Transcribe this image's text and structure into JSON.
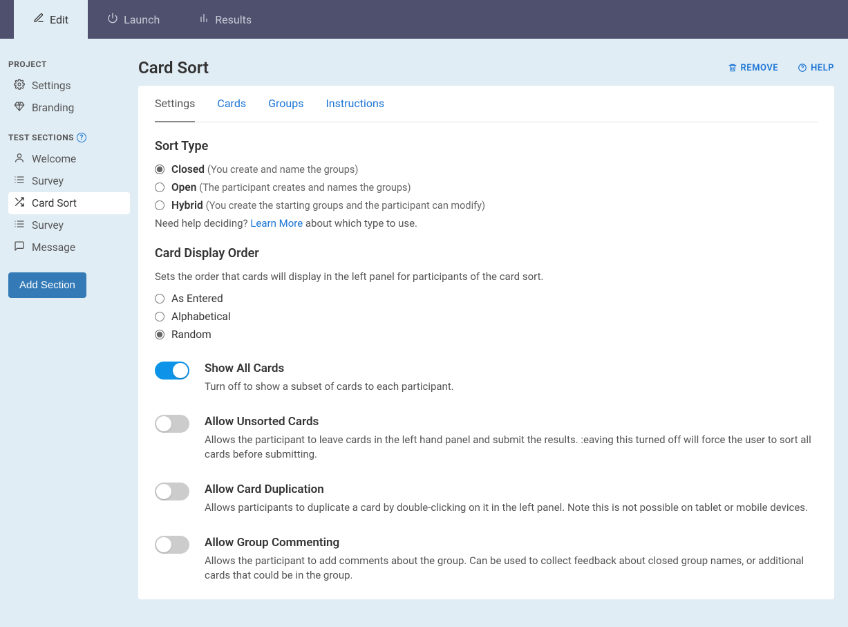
{
  "topnav": [
    {
      "label": "Edit",
      "active": true,
      "icon": "edit"
    },
    {
      "label": "Launch",
      "active": false,
      "icon": "power"
    },
    {
      "label": "Results",
      "active": false,
      "icon": "bars"
    }
  ],
  "sidebar": {
    "projectHeading": "PROJECT",
    "projectItems": [
      {
        "label": "Settings",
        "icon": "gear"
      },
      {
        "label": "Branding",
        "icon": "diamond"
      }
    ],
    "sectionsHeading": "TEST SECTIONS",
    "sectionItems": [
      {
        "label": "Welcome",
        "icon": "person",
        "active": false
      },
      {
        "label": "Survey",
        "icon": "list",
        "active": false
      },
      {
        "label": "Card Sort",
        "icon": "shuffle",
        "active": true
      },
      {
        "label": "Survey",
        "icon": "list",
        "active": false
      },
      {
        "label": "Message",
        "icon": "chat",
        "active": false
      }
    ],
    "addSection": "Add Section"
  },
  "page": {
    "title": "Card Sort",
    "remove": "REMOVE",
    "help": "HELP"
  },
  "tabs": [
    {
      "label": "Settings",
      "active": true
    },
    {
      "label": "Cards",
      "active": false
    },
    {
      "label": "Groups",
      "active": false
    },
    {
      "label": "Instructions",
      "active": false
    }
  ],
  "sortType": {
    "heading": "Sort Type",
    "options": [
      {
        "value": "closed",
        "label": "Closed",
        "hint": "(You create and name the groups)",
        "checked": true
      },
      {
        "value": "open",
        "label": "Open",
        "hint": "(The participant creates and names the groups)",
        "checked": false
      },
      {
        "value": "hybrid",
        "label": "Hybrid",
        "hint": "(You create the starting groups and the participant can modify)",
        "checked": false
      }
    ],
    "helpPrefix": "Need help deciding? ",
    "helpLink": "Learn More",
    "helpSuffix": " about which type to use."
  },
  "displayOrder": {
    "heading": "Card Display Order",
    "desc": "Sets the order that cards will display in the left panel for participants of the card sort.",
    "options": [
      {
        "value": "entered",
        "label": "As Entered",
        "checked": false
      },
      {
        "value": "alpha",
        "label": "Alphabetical",
        "checked": false
      },
      {
        "value": "random",
        "label": "Random",
        "checked": true
      }
    ]
  },
  "toggles": [
    {
      "id": "show-all",
      "title": "Show All Cards",
      "desc": "Turn off to show a subset of cards to each participant.",
      "on": true
    },
    {
      "id": "unsorted",
      "title": "Allow Unsorted Cards",
      "desc": "Allows the participant to leave cards in the left hand panel and submit the results. :eaving this turned off will force the user to sort all cards before submitting.",
      "on": false
    },
    {
      "id": "duplication",
      "title": "Allow Card Duplication",
      "desc": "Allows participants to duplicate a card by double-clicking on it in the left panel. Note this is not possible on tablet or mobile devices.",
      "on": false
    },
    {
      "id": "commenting",
      "title": "Allow Group Commenting",
      "desc": "Allows the participant to add comments about the group. Can be used to collect feedback about closed group names, or additional cards that could be in the group.",
      "on": false
    }
  ]
}
